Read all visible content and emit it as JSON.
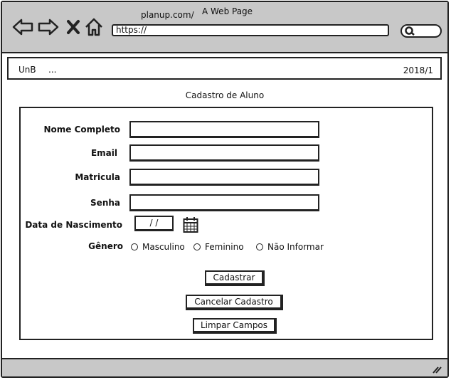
{
  "browser": {
    "site": "planup.com/",
    "title": "A Web Page",
    "url": "https://"
  },
  "header": {
    "left_label": "UnB",
    "left_more": "...",
    "right_label": "2018/1"
  },
  "form": {
    "title": "Cadastro de Aluno",
    "fields": {
      "name_label": "Nome Completo",
      "email_label": "Email",
      "matricula_label": "Matricula",
      "senha_label": "Senha",
      "birth_label": "Data de Nascimento",
      "birth_value": "/ /",
      "gender_label": "Gênero"
    },
    "gender_options": [
      "Masculino",
      "Feminino",
      "Não Informar"
    ],
    "buttons": {
      "submit": "Cadastrar",
      "cancel": "Cancelar Cadastro",
      "clear": "Limpar Campos"
    }
  }
}
